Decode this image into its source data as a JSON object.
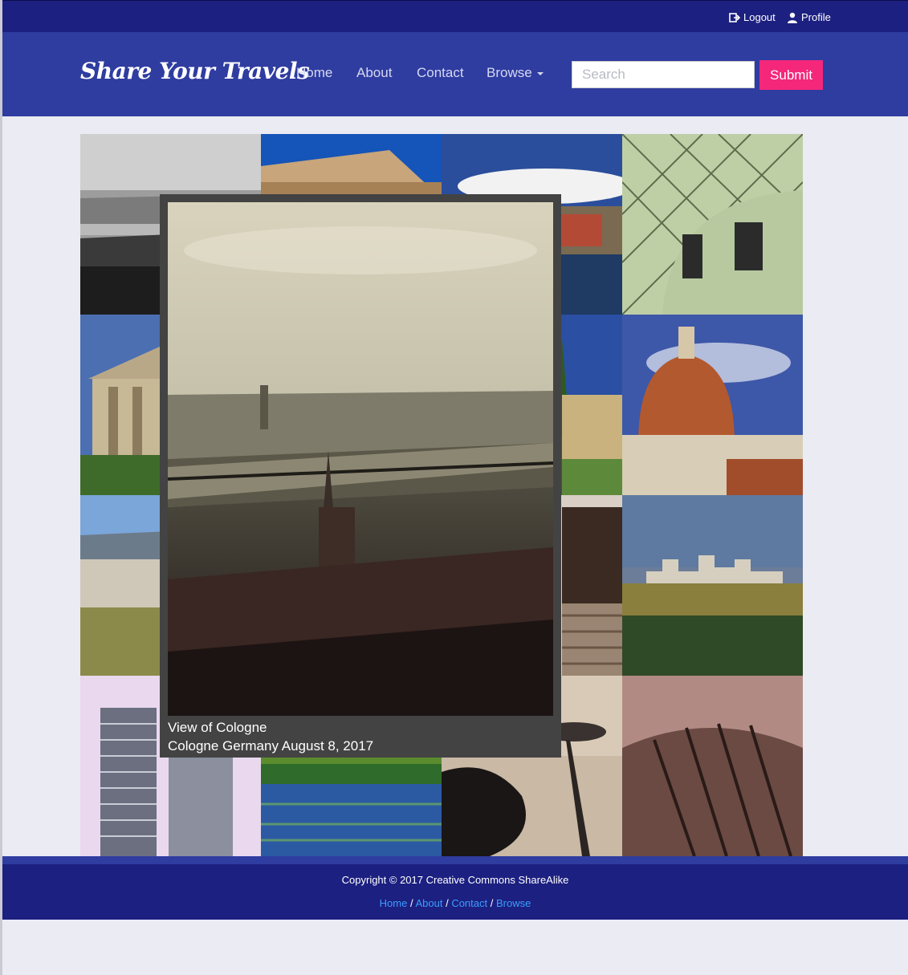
{
  "top_bar": {
    "logout_label": "Logout",
    "profile_label": "Profile",
    "logout_icon": "logout-icon",
    "profile_icon": "user-icon"
  },
  "navbar": {
    "brand": "Share Your Travels",
    "links": [
      "Home",
      "About",
      "Contact",
      "Browse"
    ],
    "search_placeholder": "Search",
    "submit_label": "Submit",
    "colors": {
      "top_bar": "#1c2080",
      "navbar": "#2f3ca0",
      "submit": "#f4277b",
      "footer_link": "#3b9dff"
    }
  },
  "gallery": {
    "tile_count": 16,
    "preview": {
      "title": "View of Cologne",
      "details": "Cologne Germany August 8, 2017"
    }
  },
  "footer": {
    "copyright": "Copyright © 2017 Creative Commons ShareAlike",
    "links": [
      "Home",
      "About",
      "Contact",
      "Browse"
    ],
    "separator": " / "
  }
}
